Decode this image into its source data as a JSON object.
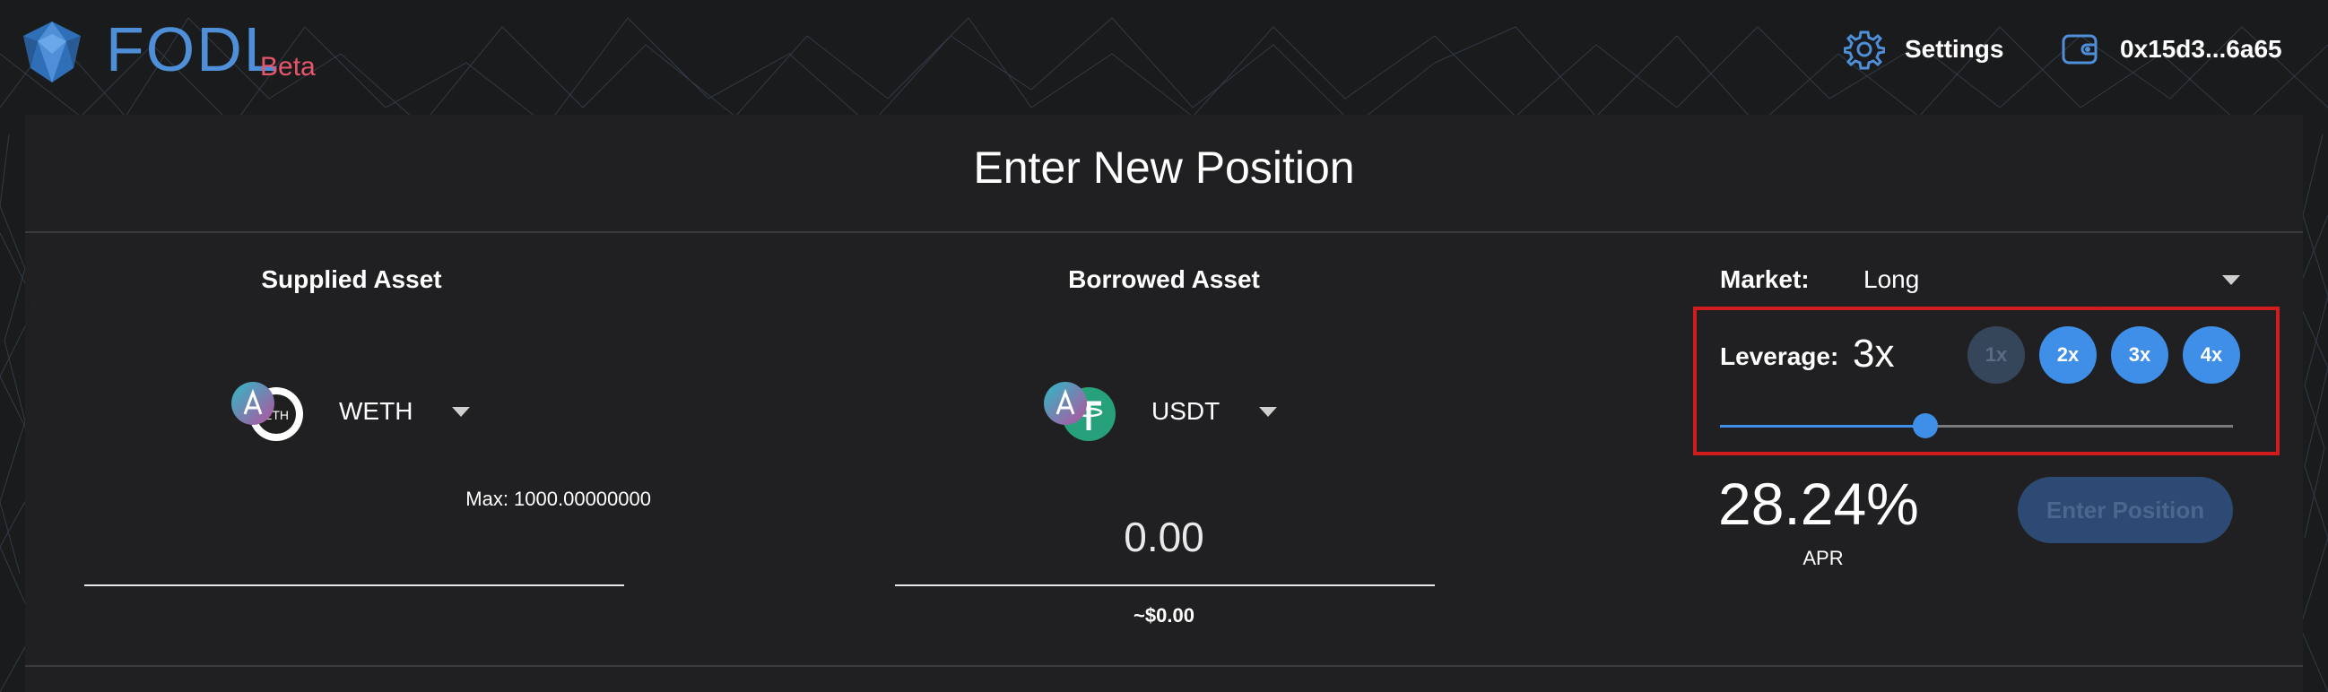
{
  "header": {
    "brand": "FODL",
    "badge": "Beta",
    "settings_label": "Settings",
    "wallet_address": "0x15d3...6a65",
    "accent_color": "#4f8fd8",
    "badge_color": "#e8566b"
  },
  "panel": {
    "title": "Enter New Position"
  },
  "supplied": {
    "title": "Supplied Asset",
    "asset": "WETH",
    "token_icon_label": "ETH",
    "max_text": "Max: 1000.00000000",
    "amount": ""
  },
  "borrowed": {
    "title": "Borrowed Asset",
    "asset": "USDT",
    "amount": "0.00",
    "usd_value": "~$0.00"
  },
  "market": {
    "label": "Market:",
    "value": "Long"
  },
  "leverage": {
    "label": "Leverage:",
    "value": "3x",
    "options": [
      {
        "label": "1x",
        "enabled": false
      },
      {
        "label": "2x",
        "enabled": true
      },
      {
        "label": "3x",
        "enabled": true
      },
      {
        "label": "4x",
        "enabled": true
      }
    ],
    "slider_fraction": 0.4
  },
  "apr": {
    "value": "28.24%",
    "label": "APR"
  },
  "actions": {
    "enter_label": "Enter Position",
    "enter_enabled": false
  },
  "icons": {
    "settings": "gear-icon",
    "wallet": "wallet-icon",
    "aave": "aave-icon",
    "eth": "eth-icon",
    "tether": "tether-icon"
  },
  "colors": {
    "primary": "#3f8fe8",
    "highlight": "#d01c1c",
    "aave_gradient": [
      "#2ebac6",
      "#b6509e"
    ],
    "tether": "#26a17b"
  }
}
